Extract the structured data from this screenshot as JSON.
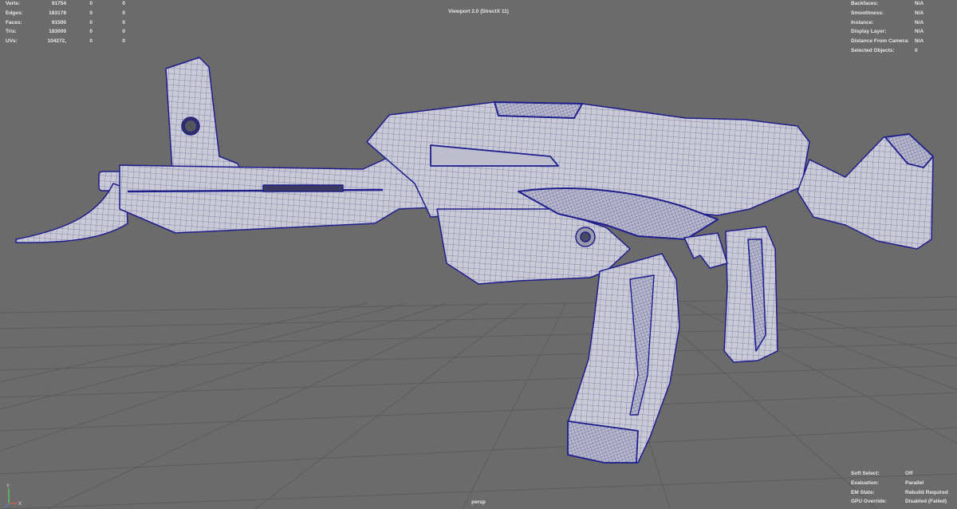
{
  "viewport": {
    "renderer": "Viewport 2.0 (DirectX 11)",
    "camera": "persp",
    "axis_labels": {
      "y": "Y",
      "x": "X"
    }
  },
  "heads_up_stats": [
    {
      "label": "Verts:",
      "values": [
        "91754",
        "0",
        "0"
      ]
    },
    {
      "label": "Edges:",
      "values": [
        "183178",
        "0",
        "0"
      ]
    },
    {
      "label": "Faces:",
      "values": [
        "91500",
        "0",
        "0"
      ]
    },
    {
      "label": "Tris:",
      "values": [
        "183000",
        "0",
        "0"
      ]
    },
    {
      "label": "UVs:",
      "values": [
        "104272,",
        "0",
        "0"
      ]
    }
  ],
  "object_details": [
    {
      "label": "Backfaces:",
      "value": "N/A"
    },
    {
      "label": "Smoothness:",
      "value": "N/A"
    },
    {
      "label": "Instance:",
      "value": "N/A"
    },
    {
      "label": "Display Layer:",
      "value": "N/A"
    },
    {
      "label": "Distance From Camera:",
      "value": "N/A"
    },
    {
      "label": "Selected Objects:",
      "value": "0"
    }
  ],
  "evaluation_details": [
    {
      "label": "Soft Select:",
      "value": "Off"
    },
    {
      "label": "Evaluation:",
      "value": "Parallel"
    },
    {
      "label": "EM State:",
      "value": "Rebuild Required"
    },
    {
      "label": "GPU Override:",
      "value": "Disabled (Failed)"
    }
  ],
  "colors": {
    "background": "#6b6b6b",
    "grid": "#5a5a5a",
    "mesh_fill": "#c9c9d6",
    "wireframe": "#1e1e8c",
    "hud_text": "#e8e8e8"
  }
}
